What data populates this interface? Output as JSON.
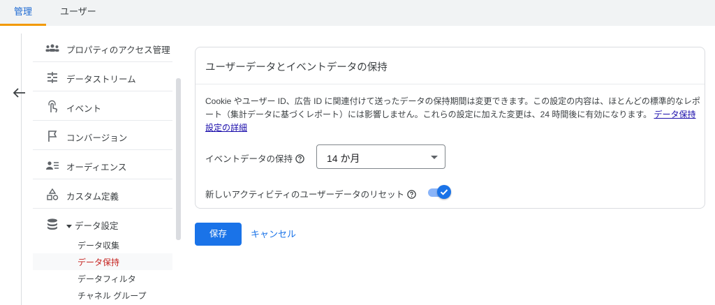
{
  "tabs": [
    {
      "label": "管理",
      "active": true
    },
    {
      "label": "ユーザー",
      "active": false
    }
  ],
  "icons": {
    "back": "arrow-back-icon"
  },
  "nav": {
    "items": [
      {
        "label": "プロパティのアクセス管理",
        "icon": "people-icon"
      },
      {
        "label": "データストリーム",
        "icon": "streams-icon"
      },
      {
        "label": "イベント",
        "icon": "touch-icon"
      },
      {
        "label": "コンバージョン",
        "icon": "flag-icon"
      },
      {
        "label": "オーディエンス",
        "icon": "audience-icon"
      },
      {
        "label": "カスタム定義",
        "icon": "shapes-icon"
      },
      {
        "label": "データ設定",
        "icon": "database-icon",
        "expanded": true
      }
    ],
    "sub_items": [
      {
        "label": "データ収集",
        "active": false
      },
      {
        "label": "データ保持",
        "active": true
      },
      {
        "label": "データフィルタ",
        "active": false
      },
      {
        "label": "チャネル グループ",
        "active": false
      }
    ]
  },
  "card": {
    "title": "ユーザーデータとイベントデータの保持",
    "description": "Cookie やユーザー ID、広告 ID に関連付けて送ったデータの保持期間は変更できます。この設定の内容は、ほとんどの標準的なレポート（集計データに基づくレポート）には影響しません。これらの設定に加えた変更は、24 時間後に有効になります。",
    "link_text": "データ保持設定の詳細",
    "event_retention_label": "イベントデータの保持",
    "event_retention_value": "14 か月",
    "reset_label": "新しいアクティビティのユーザーデータのリセット",
    "reset_enabled": true
  },
  "actions": {
    "save": "保存",
    "cancel": "キャンセル"
  },
  "colors": {
    "accent": "#1a73e8",
    "tab_underline": "#f29900",
    "active_sub_item": "#c5221f"
  }
}
